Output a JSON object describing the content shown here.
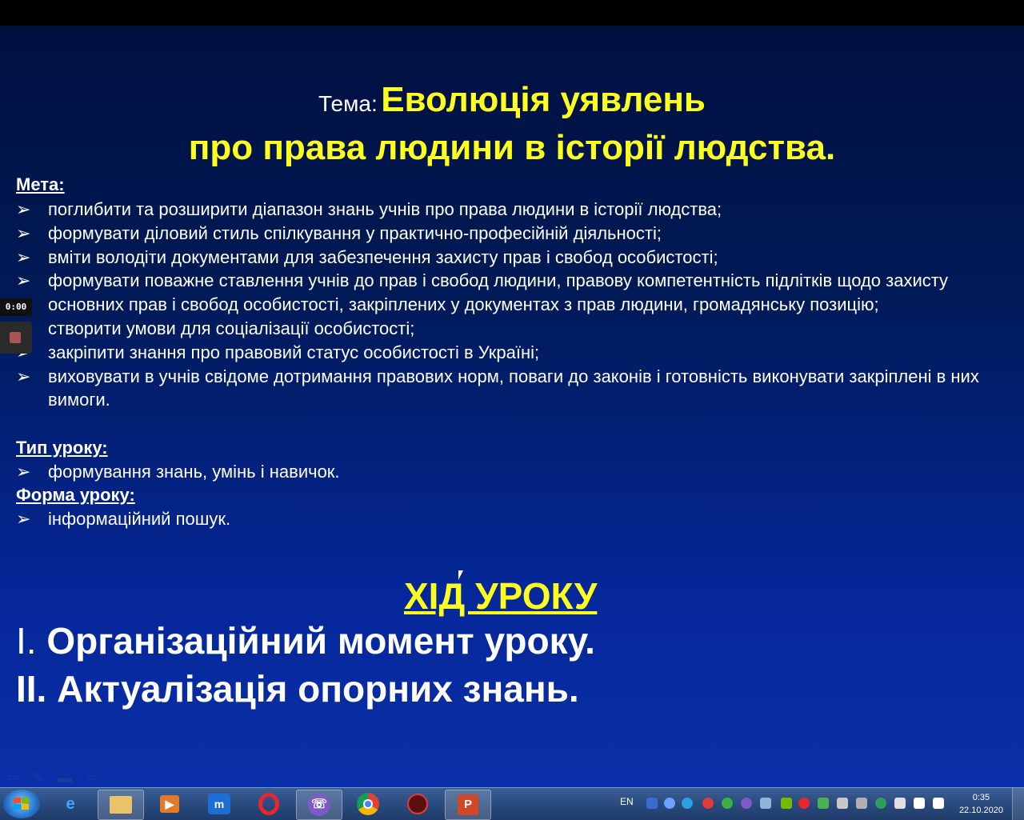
{
  "slide": {
    "title_prefix": "Тема:",
    "title_line1": "Еволюція уявлень",
    "title_line2": "про права людини в історії людства.",
    "goal_heading": "Мета:",
    "goal_items": [
      "поглибити та розширити діапазон знань учнів про права людини в історії людства;",
      "формувати діловий стиль спілкування у практично-професійній діяльності;",
      "вміти володіти документами для забезпечення захисту прав і свобод особистості;",
      "формувати поважне ставлення учнів до прав і свобод людини, правову компетентність підлітків щодо захисту основних прав і свобод особистості, закріплених у документах з прав людини, громадянську позицію;",
      "створити умови для соціалізації особистості;",
      "закріпити знання про правовий статус особистості в Україні;",
      "виховувати в учнів свідоме дотримання правових норм, поваги  до законів і готовність виконувати закріплені в них вимоги."
    ],
    "type_heading": "Тип уроку:",
    "type_items": [
      "формування знань, умінь і навичок."
    ],
    "form_heading": "Форма уроку:",
    "form_items": [
      "інформаційний пошук."
    ],
    "lesson_heading": "ХІД УРОКУ",
    "step1_num": "I.",
    "step1_text": "Організаційний момент уроку.",
    "step2_text": "II. Актуалізація опорних знань."
  },
  "recorder": {
    "time": "0:00"
  },
  "taskbar": {
    "apps": [
      "start-menu",
      "internet-explorer",
      "file-explorer",
      "media-player",
      "maxthon",
      "opera",
      "viber",
      "chrome",
      "game-app",
      "powerpoint"
    ],
    "language": "EN",
    "clock_time": "0:35",
    "clock_date": "22.10.2020"
  },
  "colors": {
    "title_yellow": "#ffff1f",
    "slide_bg_top": "#00103f",
    "slide_bg_bottom": "#0a2fa8"
  }
}
